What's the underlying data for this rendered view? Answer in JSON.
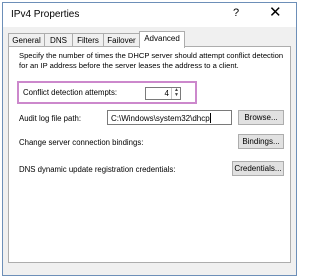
{
  "window": {
    "title": "IPv4 Properties",
    "help_label": "?",
    "close_label": "✕"
  },
  "tabs": [
    {
      "label": "General",
      "active": false
    },
    {
      "label": "DNS",
      "active": false
    },
    {
      "label": "Filters",
      "active": false
    },
    {
      "label": "Failover",
      "active": false
    },
    {
      "label": "Advanced",
      "active": true
    }
  ],
  "advanced": {
    "description": "Specify the number of times the DHCP server should attempt conflict detection for an IP address before the server leases the address to a client.",
    "conflict_label": "Conflict detection attempts:",
    "conflict_value": "4",
    "audit_label": "Audit log file path:",
    "audit_value": "C:\\Windows\\system32\\dhcp",
    "browse_label": "Browse...",
    "bindings_label": "Change server connection bindings:",
    "bindings_button": "Bindings...",
    "credentials_label": "DNS dynamic update registration credentials:",
    "credentials_button": "Credentials..."
  },
  "colors": {
    "highlight": "#cc88cc",
    "titlebar": "#ffffff",
    "dialog_bg": "#f0f0f0"
  }
}
